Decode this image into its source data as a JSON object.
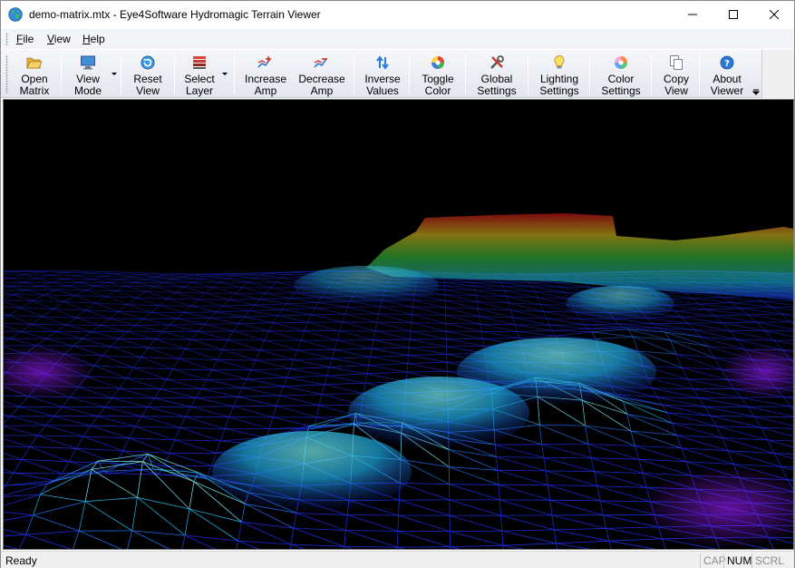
{
  "window": {
    "title": "demo-matrix.mtx - Eye4Software Hydromagic Terrain Viewer",
    "app_icon": "globe-icon"
  },
  "menu": [
    {
      "accel": "F",
      "rest": "ile"
    },
    {
      "accel": "V",
      "rest": "iew"
    },
    {
      "accel": "H",
      "rest": "elp"
    }
  ],
  "toolbar": {
    "open_matrix": "Open\nMatrix",
    "view_mode": "View\nMode",
    "reset_view": "Reset\nView",
    "select_layer": "Select\nLayer",
    "increase_amp": "Increase\nAmp",
    "decrease_amp": "Decrease\nAmp",
    "inverse_values": "Inverse\nValues",
    "toggle_color": "Toggle\nColor",
    "global_settings": "Global\nSettings",
    "lighting_settings": "Lighting\nSettings",
    "color_settings": "Color\nSettings",
    "copy_view": "Copy\nView",
    "about_viewer": "About\nViewer"
  },
  "status": {
    "text": "Ready",
    "cap": "CAP",
    "num": "NUM",
    "scrl": "SCRL"
  },
  "colors": {
    "viewport_bg": "#000000",
    "wire_low": "#1a1aff",
    "wire_mid": "#1ec8e6",
    "wire_high": "#ff2a00"
  }
}
